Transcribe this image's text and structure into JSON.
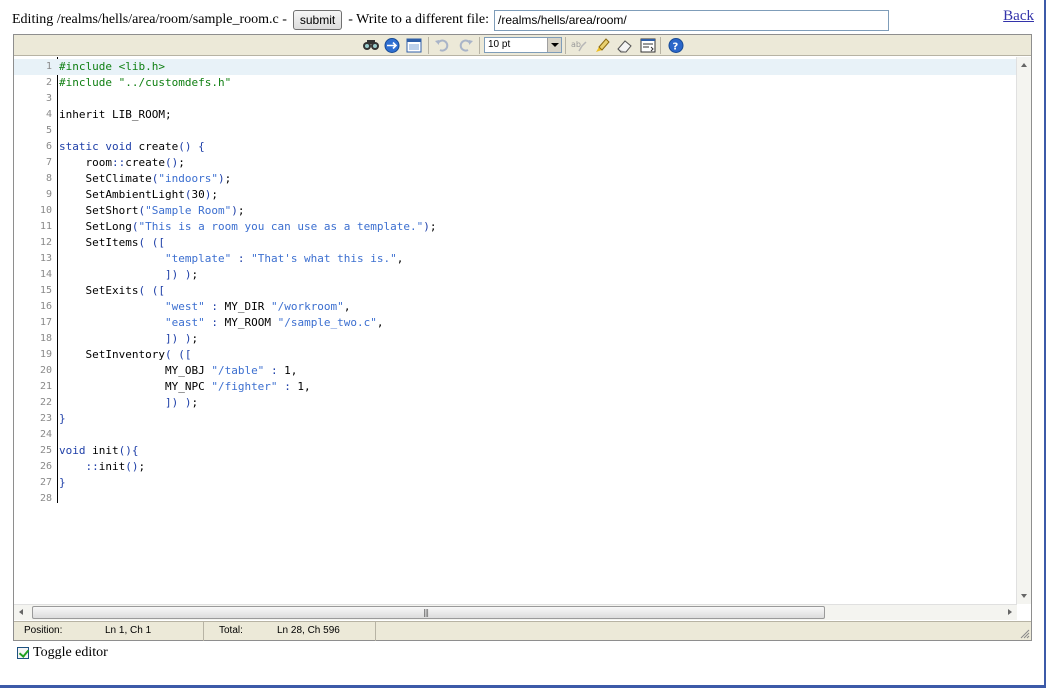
{
  "header": {
    "editing_label": "Editing /realms/hells/area/room/sample_room.c -",
    "submit_label": "submit",
    "write_label": "- Write to a different file:",
    "file_value": "/realms/hells/area/room/",
    "back_label": "Back"
  },
  "toolbar": {
    "font_size": "10 pt",
    "icons": [
      "search-icon",
      "goto-line-icon",
      "fullscreen-icon",
      "undo-icon",
      "redo-icon",
      "spellcheck-icon",
      "highlight-icon",
      "reset-icon",
      "word-wrap-icon",
      "help-icon"
    ]
  },
  "code": {
    "lines": [
      {
        "n": "1",
        "html": "<span class=\"pre\">#include &lt;lib.h&gt;</span>"
      },
      {
        "n": "2",
        "html": "<span class=\"pre\">#include \"../customdefs.h\"</span>"
      },
      {
        "n": "3",
        "html": ""
      },
      {
        "n": "4",
        "html": "inherit LIB_ROOM;"
      },
      {
        "n": "5",
        "html": ""
      },
      {
        "n": "6",
        "html": "<span class=\"kw\">static void</span> create<span class=\"op\">()</span> <span class=\"op\">{</span>"
      },
      {
        "n": "7",
        "html": "    room<span class=\"op\">::</span>create<span class=\"op\">()</span>;"
      },
      {
        "n": "8",
        "html": "    SetClimate<span class=\"op\">(</span><span class=\"str\">\"indoors\"</span><span class=\"op\">)</span>;"
      },
      {
        "n": "9",
        "html": "    SetAmbientLight<span class=\"op\">(</span>30<span class=\"op\">)</span>;"
      },
      {
        "n": "10",
        "html": "    SetShort<span class=\"op\">(</span><span class=\"str\">\"Sample Room\"</span><span class=\"op\">)</span>;"
      },
      {
        "n": "11",
        "html": "    SetLong<span class=\"op\">(</span><span class=\"str\">\"This is a room you can use as a template.\"</span><span class=\"op\">)</span>;"
      },
      {
        "n": "12",
        "html": "    SetItems<span class=\"op\">(</span> <span class=\"op\">([</span>"
      },
      {
        "n": "13",
        "html": "                <span class=\"str\">\"template\"</span> <span class=\"op\">:</span> <span class=\"str\">\"That's what this is.\"</span>,"
      },
      {
        "n": "14",
        "html": "                <span class=\"op\">])</span> <span class=\"op\">)</span>;"
      },
      {
        "n": "15",
        "html": "    SetExits<span class=\"op\">(</span> <span class=\"op\">([</span>"
      },
      {
        "n": "16",
        "html": "                <span class=\"str\">\"west\"</span> <span class=\"op\">:</span> MY_DIR <span class=\"str\">\"/workroom\"</span>,"
      },
      {
        "n": "17",
        "html": "                <span class=\"str\">\"east\"</span> <span class=\"op\">:</span> MY_ROOM <span class=\"str\">\"/sample_two.c\"</span>,"
      },
      {
        "n": "18",
        "html": "                <span class=\"op\">])</span> <span class=\"op\">)</span>;"
      },
      {
        "n": "19",
        "html": "    SetInventory<span class=\"op\">(</span> <span class=\"op\">([</span>"
      },
      {
        "n": "20",
        "html": "                MY_OBJ <span class=\"str\">\"/table\"</span> <span class=\"op\">:</span> 1,"
      },
      {
        "n": "21",
        "html": "                MY_NPC <span class=\"str\">\"/fighter\"</span> <span class=\"op\">:</span> 1,"
      },
      {
        "n": "22",
        "html": "                <span class=\"op\">])</span> <span class=\"op\">)</span>;"
      },
      {
        "n": "23",
        "html": "<span class=\"op\">}</span>"
      },
      {
        "n": "24",
        "html": ""
      },
      {
        "n": "25",
        "html": "<span class=\"kw\">void</span> init<span class=\"op\">(){</span>"
      },
      {
        "n": "26",
        "html": "    <span class=\"op\">::</span>init<span class=\"op\">()</span>;"
      },
      {
        "n": "27",
        "html": "<span class=\"op\">}</span>"
      },
      {
        "n": "28",
        "html": ""
      }
    ]
  },
  "status": {
    "position_label": "Position:",
    "position_value": "Ln 1, Ch 1",
    "total_label": "Total:",
    "total_value": "Ln 28, Ch 596"
  },
  "toggle": {
    "label": "Toggle editor",
    "checked": true
  }
}
